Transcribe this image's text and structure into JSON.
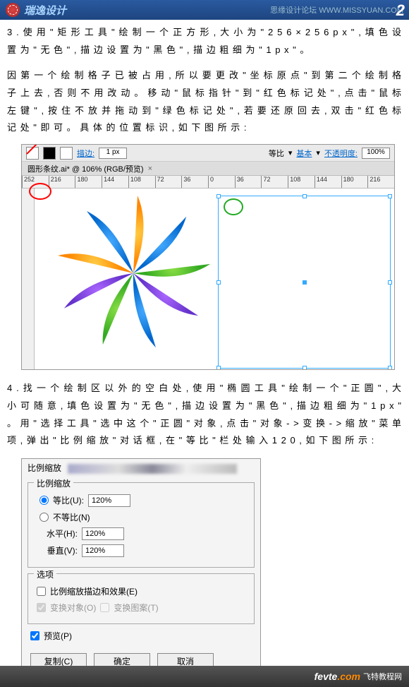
{
  "header": {
    "title": "瑞逸设计",
    "right_text": "思缘设计论坛 WWW.MISSYUAN.COM",
    "page_num": "2"
  },
  "para1": "3 . 使 用 \" 矩 形 工 具 \" 绘 制 一 个 正 方 形 , 大 小 为 \" 2 5 6 × 2 5 6  p x \" , 填 色 设 置 为 \" 无 色 \" , 描 边 设 置 为 \" 黑 色 \" , 描 边 粗 细 为 \" 1  p x \" 。",
  "para2": "因 第 一 个 绘 制 格 子 已 被 占 用 , 所 以 要 更 改 \" 坐 标 原 点 \" 到 第 二 个 绘 制 格 子 上 去 , 否 则 不 用 改 动 。 移 动 \" 鼠 标 指 针 \" 到 \" 红 色 标 记 处 \" , 点 击 \" 鼠 标 左 键 \" , 按 住 不 放 并 拖 动 到 \" 绿 色 标 记 处 \" , 若 要 还 原 回 去 , 双 击 \" 红 色 标 记 处 \" 即 可 。 具 体 的 位 置 标 识 , 如 下 图 所 示 :",
  "ai": {
    "stroke_label": "描边:",
    "stroke_val": "1 px",
    "ratio_label": "等比",
    "basic_label": "基本",
    "opacity_label": "不透明度:",
    "opacity_val": "100%",
    "tab_name": "圆形条纹.ai* @ 106% (RGB/预览)",
    "tab_close": "×",
    "ruler_ticks": [
      "252",
      "216",
      "180",
      "144",
      "108",
      "72",
      "36",
      "0",
      "36",
      "72",
      "108",
      "144",
      "180",
      "216"
    ]
  },
  "para3": "4 . 找 一 个 绘 制 区 以 外 的 空 白 处 , 使 用 \" 椭 圆 工 具 \" 绘 制 一 个 \" 正 圆 \" , 大 小 可 随 意 , 填 色 设 置 为 \" 无 色 \" , 描 边 设 置 为 \" 黑 色 \" , 描 边 粗 细 为 \" 1  p x \" 。 用 \" 选 择 工 具 \" 选 中 这 个 \" 正 圆 \" 对 象 , 点 击 \" 对 象  - >  变 换  - >  缩 放 \" 菜 单 项 , 弹 出 \" 比 例 缩 放 \" 对 话 框 , 在 \" 等 比 \" 栏 处 输 入 1 2 0 , 如 下 图 所 示 :",
  "dialog": {
    "title_prefix": "比例缩放",
    "group_scale": "比例缩放",
    "uniform_label": "等比(U):",
    "uniform_val": "120%",
    "nonuniform_label": "不等比(N)",
    "horiz_label": "水平(H):",
    "horiz_val": "120%",
    "vert_label": "垂直(V):",
    "vert_val": "120%",
    "group_options": "选项",
    "scale_strokes": "比例缩放描边和效果(E)",
    "transform_objects": "变换对象(O)",
    "transform_patterns": "变换图案(T)",
    "preview": "预览(P)",
    "btn_copy": "复制(C)",
    "btn_ok": "确定",
    "btn_cancel": "取消"
  },
  "footer": {
    "brand1": "fevte",
    "brand2": ".com",
    "sub": "飞特教程网"
  }
}
